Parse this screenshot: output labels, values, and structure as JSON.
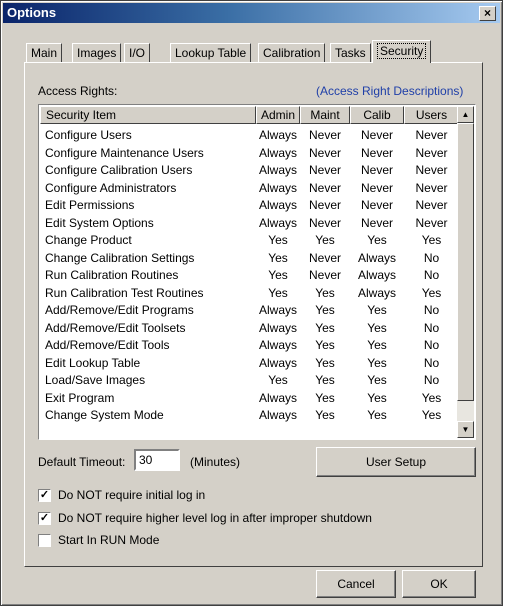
{
  "window": {
    "title": "Options",
    "close_glyph": "×"
  },
  "tabs": [
    {
      "label": "Main",
      "active": false
    },
    {
      "label": "Images",
      "active": false
    },
    {
      "label": "I/O",
      "active": false
    },
    {
      "label": "Lookup Table",
      "active": false
    },
    {
      "label": "Calibration",
      "active": false
    },
    {
      "label": "Tasks",
      "active": false
    },
    {
      "label": "Security",
      "active": true
    }
  ],
  "security": {
    "access_rights_label": "Access Rights:",
    "descriptions_link": "(Access Right Descriptions)",
    "columns": [
      "Security Item",
      "Admin",
      "Maint",
      "Calib",
      "Users"
    ],
    "rows": [
      [
        "Configure Users",
        "Always",
        "Never",
        "Never",
        "Never"
      ],
      [
        "Configure Maintenance Users",
        "Always",
        "Never",
        "Never",
        "Never"
      ],
      [
        "Configure Calibration Users",
        "Always",
        "Never",
        "Never",
        "Never"
      ],
      [
        "Configure Administrators",
        "Always",
        "Never",
        "Never",
        "Never"
      ],
      [
        "Edit Permissions",
        "Always",
        "Never",
        "Never",
        "Never"
      ],
      [
        "Edit System Options",
        "Always",
        "Never",
        "Never",
        "Never"
      ],
      [
        "Change Product",
        "Yes",
        "Yes",
        "Yes",
        "Yes"
      ],
      [
        "Change Calibration Settings",
        "Yes",
        "Never",
        "Always",
        "No"
      ],
      [
        "Run Calibration Routines",
        "Yes",
        "Never",
        "Always",
        "No"
      ],
      [
        "Run Calibration Test Routines",
        "Yes",
        "Yes",
        "Always",
        "Yes"
      ],
      [
        "Add/Remove/Edit Programs",
        "Always",
        "Yes",
        "Yes",
        "No"
      ],
      [
        "Add/Remove/Edit Toolsets",
        "Always",
        "Yes",
        "Yes",
        "No"
      ],
      [
        "Add/Remove/Edit Tools",
        "Always",
        "Yes",
        "Yes",
        "No"
      ],
      [
        "Edit Lookup Table",
        "Always",
        "Yes",
        "Yes",
        "No"
      ],
      [
        "Load/Save Images",
        "Yes",
        "Yes",
        "Yes",
        "No"
      ],
      [
        "Exit Program",
        "Always",
        "Yes",
        "Yes",
        "Yes"
      ],
      [
        "Change System Mode",
        "Always",
        "Yes",
        "Yes",
        "Yes"
      ]
    ],
    "scroll_up_glyph": "▲",
    "scroll_down_glyph": "▼"
  },
  "timeout": {
    "label": "Default Timeout:",
    "value": "30",
    "unit": "(Minutes)"
  },
  "user_setup_button": "User Setup",
  "checkboxes": [
    {
      "label": "Do NOT require initial log in",
      "checked": true
    },
    {
      "label": "Do NOT require higher level log in after improper shutdown",
      "checked": true
    },
    {
      "label": "Start In RUN Mode",
      "checked": false
    }
  ],
  "check_glyph": "✓",
  "buttons": {
    "cancel": "Cancel",
    "ok": "OK"
  }
}
